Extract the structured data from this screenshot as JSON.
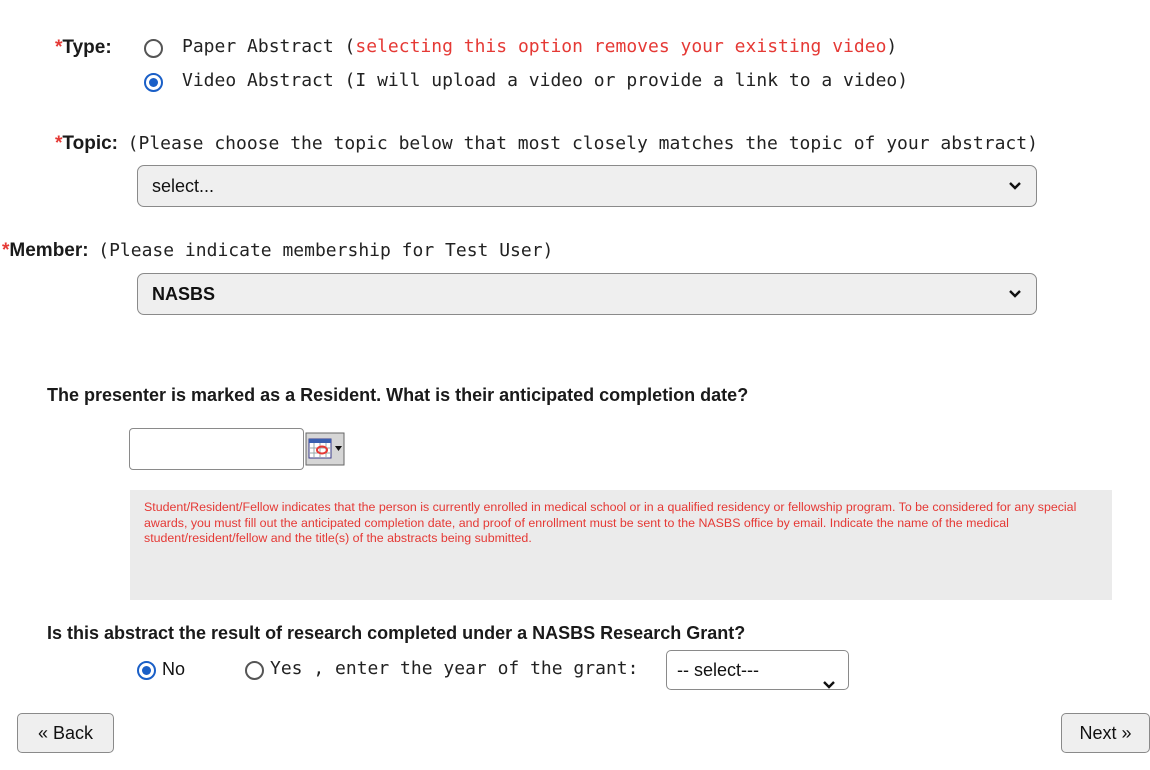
{
  "type_field": {
    "required_mark": "*",
    "label": "Type:",
    "options": [
      {
        "label": "Paper Abstract (",
        "note": "selecting this option removes your existing video",
        "suffix": ")",
        "selected": false
      },
      {
        "label": "Video Abstract (I will upload a video or provide a link to a video)",
        "selected": true
      }
    ]
  },
  "topic_field": {
    "required_mark": "*",
    "label": "Topic:",
    "hint": "(Please choose the topic below that most closely matches the topic of your abstract)",
    "selected": "select..."
  },
  "member_field": {
    "required_mark": "*",
    "label": "Member:",
    "hint": "(Please indicate membership for Test User)",
    "selected": "NASBS"
  },
  "completion_date": {
    "question": "The presenter is marked as a Resident. What is their anticipated completion date?",
    "value": ""
  },
  "notice": "Student/Resident/Fellow indicates that the person is currently enrolled in medical school or in a qualified residency or fellowship program. To be considered for any special awards, you must fill out the anticipated completion date, and proof of enrollment must be sent to the NASBS office by email. Indicate the name of the medical student/resident/fellow and the title(s) of the abstracts being submitted.",
  "grant": {
    "question": "Is this abstract the result of research completed under a NASBS Research Grant?",
    "no_label": "No",
    "yes_label": "Yes , enter the year of the grant:",
    "no_selected": true,
    "year_selected": "-- select---"
  },
  "nav": {
    "back": "« Back",
    "next": "Next »"
  },
  "colors": {
    "required": "#e53935",
    "radio_selected": "#1a5fc7",
    "notice_bg": "#ebebeb"
  }
}
